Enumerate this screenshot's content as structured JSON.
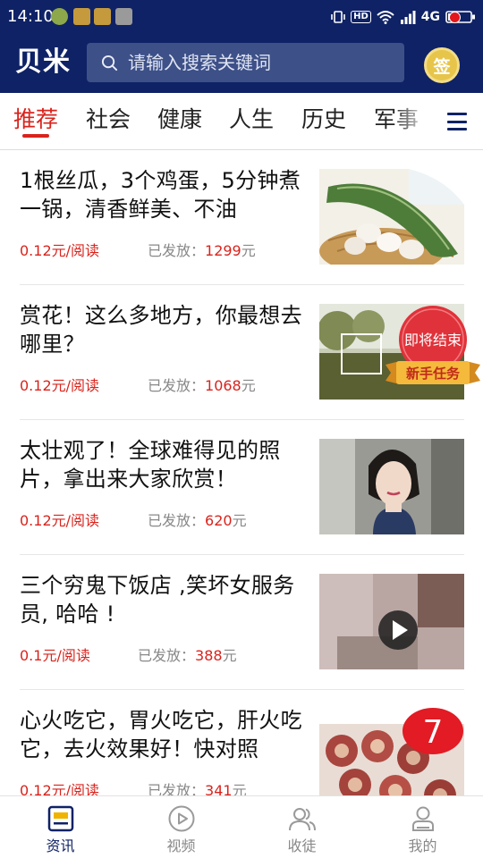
{
  "status_bar": {
    "time": "14:10",
    "network": "4G",
    "hd": "HD",
    "icons": [
      "vibrate-icon",
      "hd-icon",
      "wifi-icon",
      "signal-icon",
      "battery-icon"
    ]
  },
  "header": {
    "logo": "贝米",
    "search_placeholder": "请输入搜索关键词",
    "signin_label": "签"
  },
  "tabs": [
    {
      "label": "推荐",
      "active": true
    },
    {
      "label": "社会",
      "active": false
    },
    {
      "label": "健康",
      "active": false
    },
    {
      "label": "人生",
      "active": false
    },
    {
      "label": "历史",
      "active": false
    },
    {
      "label": "军事",
      "active": false
    }
  ],
  "feed": [
    {
      "title": "1根丝瓜，3个鸡蛋，5分钟煮一锅，清香鲜美、不油",
      "price": "0.12元/阅读",
      "sent_label": "已发放：",
      "sent_count": "1299",
      "sent_unit": "元"
    },
    {
      "title": "赏花！这么多地方，你最想去哪里？",
      "price": "0.12元/阅读",
      "sent_label": "已发放：",
      "sent_count": "1068",
      "sent_unit": "元"
    },
    {
      "title": "太壮观了！全球难得见的照片，拿出来大家欣赏！",
      "price": "0.12元/阅读",
      "sent_label": "已发放：",
      "sent_count": "620",
      "sent_unit": "元"
    },
    {
      "title": "三个穷鬼下饭店 ,笑坏女服务员, 哈哈 !",
      "price": "0.1元/阅读",
      "sent_label": "已发放：",
      "sent_count": "388",
      "sent_unit": "元"
    },
    {
      "title": "心火吃它，胃火吃它，肝火吃它，去火效果好！快对照",
      "price": "0.12元/阅读",
      "sent_label": "已发放：",
      "sent_count": "341",
      "sent_unit": "元"
    }
  ],
  "promo_badge": {
    "line1": "即将结束",
    "line2": "新手任务"
  },
  "red_badge": {
    "number": "7"
  },
  "bottom_nav": [
    {
      "label": "资讯",
      "icon": "news-icon",
      "active": true
    },
    {
      "label": "视频",
      "icon": "play-icon",
      "active": false
    },
    {
      "label": "收徒",
      "icon": "people-icon",
      "active": false
    },
    {
      "label": "我的",
      "icon": "user-icon",
      "active": false
    }
  ],
  "colors": {
    "primary": "#0f2266",
    "accent_red": "#d9231c",
    "search_bg": "#3d5088",
    "gold": "#e6c54a"
  }
}
